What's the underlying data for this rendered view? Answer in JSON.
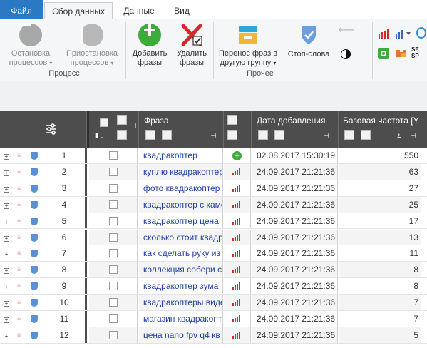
{
  "tabs": {
    "file": "Файл",
    "collect": "Сбор данных",
    "data": "Данные",
    "view": "Вид"
  },
  "ribbon": {
    "stop_line1": "Остановка",
    "stop_line2": "процессов",
    "pause_line1": "Приостановка",
    "pause_line2": "процессов",
    "group_process": "Процесс",
    "add_line1": "Добавить",
    "add_line2": "фразы",
    "delete_line1": "Удалить",
    "delete_line2": "фразы",
    "move_line1": "Перенос фраз в",
    "move_line2": "другую группу",
    "stopwords": "Стоп-слова",
    "group_other": "Прочее",
    "seo_text": "SE\nSP"
  },
  "grid": {
    "headers": {
      "phrase": "Фраза",
      "date": "Дата добавления",
      "freq": "Базовая частота [Y",
      "sigma": "Σ"
    },
    "rows": [
      {
        "num": "1",
        "phrase": "квадракоптер",
        "source": "plus",
        "date": "02.08.2017 15:30:19",
        "freq": "550"
      },
      {
        "num": "2",
        "phrase": "куплю квадракоптер",
        "source": "bars",
        "date": "24.09.2017 21:21:36",
        "freq": "63"
      },
      {
        "num": "3",
        "phrase": "фото квадракоптер",
        "source": "bars",
        "date": "24.09.2017 21:21:36",
        "freq": "27"
      },
      {
        "num": "4",
        "phrase": "квадракоптер с камерой",
        "source": "bars",
        "date": "24.09.2017 21:21:36",
        "freq": "25"
      },
      {
        "num": "5",
        "phrase": "квадракоптер цена",
        "source": "bars",
        "date": "24.09.2017 21:21:36",
        "freq": "17"
      },
      {
        "num": "6",
        "phrase": "сколько стоит квадракоптер",
        "source": "bars",
        "date": "24.09.2017 21:21:36",
        "freq": "13"
      },
      {
        "num": "7",
        "phrase": "как сделать руку из",
        "source": "bars",
        "date": "24.09.2017 21:21:36",
        "freq": "11"
      },
      {
        "num": "8",
        "phrase": "коллекция собери с",
        "source": "bars",
        "date": "24.09.2017 21:21:36",
        "freq": "8"
      },
      {
        "num": "9",
        "phrase": "квадракоптер зума",
        "source": "bars",
        "date": "24.09.2017 21:21:36",
        "freq": "8"
      },
      {
        "num": "10",
        "phrase": "квадракоптеры видео",
        "source": "bars",
        "date": "24.09.2017 21:21:36",
        "freq": "7"
      },
      {
        "num": "11",
        "phrase": "магазин квадракоптеров",
        "source": "bars",
        "date": "24.09.2017 21:21:36",
        "freq": "7"
      },
      {
        "num": "12",
        "phrase": "цена nano fpv q4 кв",
        "source": "bars",
        "date": "24.09.2017 21:21:36",
        "freq": "5"
      }
    ]
  },
  "colors": {
    "file_tab": "#2b79c2",
    "header_bg": "#4d4d4d",
    "phrase_text": "#1f3fa8",
    "add_green": "#3cab3a",
    "delete_red": "#d9262b",
    "bars_red": "#d42a2a"
  }
}
